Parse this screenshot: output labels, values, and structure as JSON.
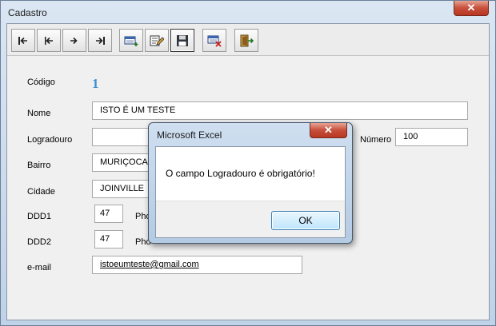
{
  "window": {
    "title": "Cadastro",
    "close_label": "✕"
  },
  "toolbar": {
    "buttons": [
      {
        "name": "first-record",
        "icon": "first-record-icon"
      },
      {
        "name": "previous-record",
        "icon": "previous-record-icon"
      },
      {
        "name": "next-record",
        "icon": "next-record-icon"
      },
      {
        "name": "last-record",
        "icon": "last-record-icon"
      },
      {
        "name": "new-record",
        "icon": "new-record-icon"
      },
      {
        "name": "edit-record",
        "icon": "edit-record-icon"
      },
      {
        "name": "save-record",
        "icon": "save-icon"
      },
      {
        "name": "delete-record",
        "icon": "delete-record-icon"
      },
      {
        "name": "exit",
        "icon": "exit-door-icon"
      }
    ]
  },
  "form": {
    "codigo_label": "Código",
    "codigo_value": "1",
    "nome_label": "Nome",
    "nome_value": "ISTO É UM TESTE",
    "logradouro_label": "Logradouro",
    "logradouro_value": "",
    "numero_label": "Número",
    "numero_value": "100",
    "bairro_label": "Bairro",
    "bairro_value": "MURIÇOCA",
    "cidade_label": "Cidade",
    "cidade_value": "JOINVILLE",
    "ddd1_label": "DDD1",
    "ddd1_value": "47",
    "phone1_label": "Pho",
    "ddd2_label": "DDD2",
    "ddd2_value": "47",
    "phone2_label": "Pho",
    "email_label": "e-mail",
    "email_value": "istoeumteste@gmail.com"
  },
  "dialog": {
    "title": "Microsoft Excel",
    "message": "O campo Logradouro é obrigatório!",
    "ok_label": "OK",
    "close_label": "✕"
  },
  "colors": {
    "accent": "#3a8fd4",
    "close_red": "#c74f3b"
  }
}
